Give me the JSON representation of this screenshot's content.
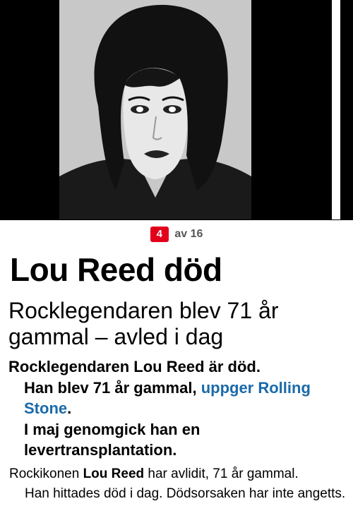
{
  "gallery": {
    "current": "4",
    "total_label": "av 16"
  },
  "article": {
    "headline": "Lou Reed död",
    "subheadline": "Rocklegendaren blev 71 år gammal – avled i dag",
    "lead_p1": "Rocklegendaren Lou Reed är död.",
    "lead_p2_text": "Han blev 71 år gammal,",
    "lead_p2_link": "uppger Rolling Stone",
    "lead_p2_end": ".",
    "lead_p3": "I maj genomgick han en levertransplantation.",
    "body_p1_start": "Rockikonen",
    "body_p1_name": "Lou Reed",
    "body_p1_end": "har avlidit, 71 år gammal.",
    "body_p2": "Han hittades död i dag. Dödsorsaken har inte angetts."
  },
  "colors": {
    "badge": "#e2001a",
    "link": "#1a6aaa"
  }
}
